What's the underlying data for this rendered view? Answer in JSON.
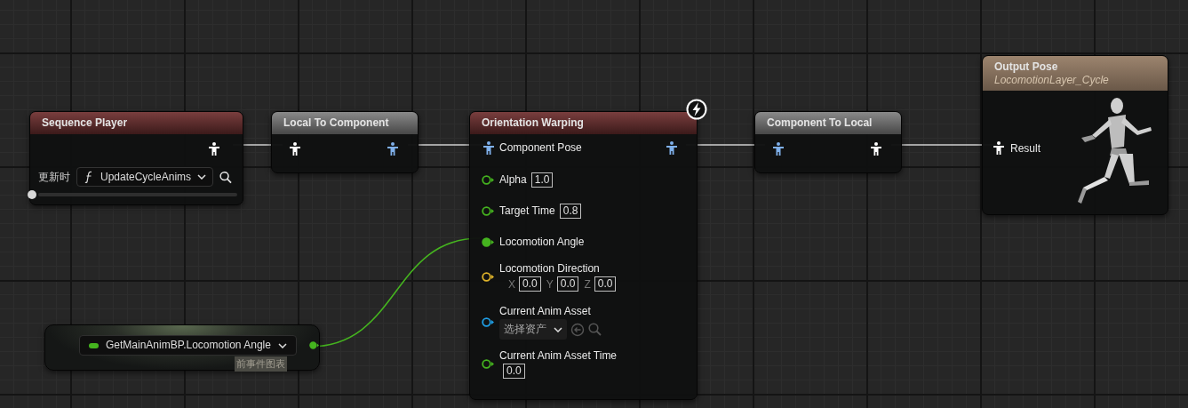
{
  "nodes": [
    {
      "kind": "sequence_player",
      "title": "Sequence Player",
      "output": {
        "color": "#ffffff"
      },
      "update_label": "更新时",
      "function": "UpdateCycleAnims",
      "level": 0
    },
    {
      "kind": "space_convert",
      "title": "Local To Component",
      "input": {
        "color": "#ffffff"
      },
      "output": {
        "color": "#7fb0ea"
      }
    },
    {
      "kind": "warp",
      "title": "Orientation Warping",
      "event_icon": true,
      "pins": [
        {
          "kind": "pose",
          "color": "#7fb0ea",
          "label": "Component Pose",
          "output": {
            "color": "#7fb0ea"
          }
        },
        {
          "kind": "value",
          "color": "#45b41f",
          "label": "Alpha",
          "connected": false,
          "values": [
            {
              "value": "1.0"
            }
          ]
        },
        {
          "kind": "value",
          "color": "#45b41f",
          "label": "Target Time",
          "connected": false,
          "values": [
            {
              "value": "0.8"
            }
          ]
        },
        {
          "kind": "value",
          "color": "#45b41f",
          "label": "Locomotion Angle",
          "connected": true
        },
        {
          "kind": "vector",
          "color": "#e0b42a",
          "label": "Locomotion Direction",
          "connected": false,
          "values": [
            {
              "axis": "X",
              "value": "0.0"
            },
            {
              "axis": "Y",
              "value": "0.0"
            },
            {
              "axis": "Z",
              "value": "0.0"
            }
          ]
        },
        {
          "kind": "asset",
          "color": "#1f9fe6",
          "label": "Current Anim Asset",
          "connected": false,
          "picker": "选择资产"
        },
        {
          "kind": "stacked",
          "color": "#45b41f",
          "label": "Current Anim Asset Time",
          "connected": false,
          "values": [
            {
              "value": "0.0"
            }
          ]
        }
      ]
    },
    {
      "kind": "space_convert",
      "title": "Component To Local",
      "input": {
        "color": "#7fb0ea"
      },
      "output": {
        "color": "#ffffff"
      }
    },
    {
      "kind": "output",
      "title": "Output Pose",
      "subtitle": "LocomotionLayer_Cycle",
      "input": {
        "color": "#ffffff",
        "label": "Result"
      }
    },
    {
      "kind": "getter",
      "label": "GetMainAnimBP.Locomotion Angle",
      "context": "前事件图表",
      "output": {
        "color": "#45b41f",
        "connected": true
      }
    }
  ]
}
